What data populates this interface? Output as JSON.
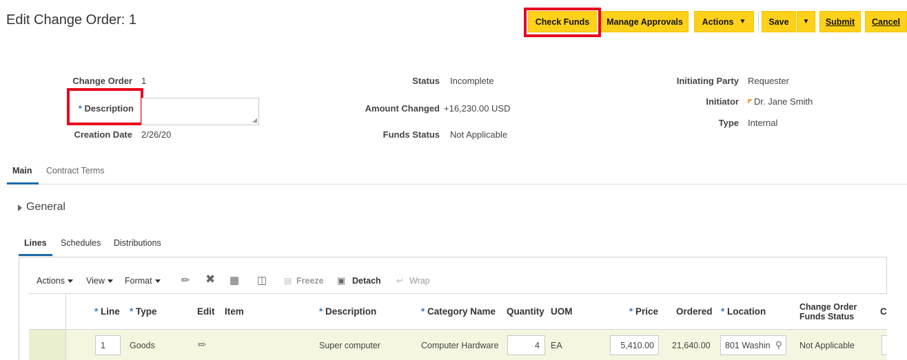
{
  "page": {
    "title": "Edit Change Order: 1"
  },
  "toolbar": {
    "check_funds": "Check Funds",
    "manage_approvals": "Manage Approvals",
    "actions": "Actions",
    "save": "Save",
    "submit": "Submit",
    "cancel": "Cancel"
  },
  "header": {
    "change_order_label": "Change Order",
    "change_order_value": "1",
    "description_label": "Description",
    "description_value": "",
    "creation_date_label": "Creation Date",
    "creation_date_value": "2/26/20",
    "status_label": "Status",
    "status_value": "Incomplete",
    "amount_changed_label": "Amount Changed",
    "amount_changed_value": "+16,230.00 USD",
    "funds_status_label": "Funds Status",
    "funds_status_value": "Not Applicable",
    "initiating_party_label": "Initiating Party",
    "initiating_party_value": "Requester",
    "initiator_label": "Initiator",
    "initiator_value": "Dr. Jane Smith",
    "type_label": "Type",
    "type_value": "Internal"
  },
  "tabs": {
    "main": "Main",
    "contract_terms": "Contract Terms"
  },
  "general": {
    "title": "General"
  },
  "subtabs": {
    "lines": "Lines",
    "schedules": "Schedules",
    "distributions": "Distributions"
  },
  "table_toolbar": {
    "actions": "Actions",
    "view": "View",
    "format": "Format",
    "freeze": "Freeze",
    "detach": "Detach",
    "wrap": "Wrap"
  },
  "table": {
    "columns": {
      "line": "Line",
      "type": "Type",
      "edit": "Edit",
      "item": "Item",
      "description": "Description",
      "category_name": "Category Name",
      "quantity": "Quantity",
      "uom": "UOM",
      "price": "Price",
      "ordered": "Ordered",
      "location": "Location",
      "funds_status_1": "Change Order",
      "funds_status_2": "Funds Status",
      "cut": "C"
    },
    "rows": [
      {
        "line": "1",
        "type": "Goods",
        "item": "",
        "description": "Super computer",
        "category_name": "Computer Hardware",
        "quantity": "4",
        "uom": "EA",
        "price": "5,410.00",
        "ordered": "21,640.00",
        "location": "801 Washin",
        "funds_status": "Not Applicable"
      }
    ]
  },
  "colors": {
    "button_yellow": "#ffd11a",
    "highlight_red": "#e8061c",
    "tab_blue": "#1c6ba8",
    "required_blue": "#2f7ec5"
  },
  "icons": [
    "edit-pencil-icon",
    "delete-x-icon",
    "freeze-icon",
    "detach-icon",
    "wrap-icon",
    "search-icon",
    "dropdown-icon",
    "expand-triangle-icon"
  ]
}
